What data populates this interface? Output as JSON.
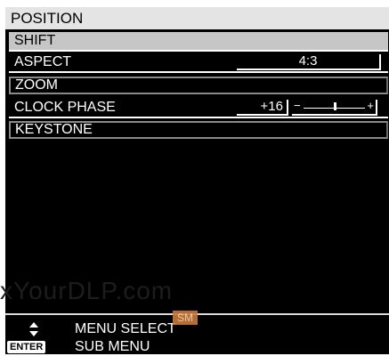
{
  "menu": {
    "title": "POSITION",
    "items": [
      {
        "label": "SHIFT"
      },
      {
        "label": "ASPECT",
        "value": "4:3"
      },
      {
        "label": "ZOOM"
      },
      {
        "label": "CLOCK PHASE",
        "value": "+16",
        "slider_min": "−",
        "slider_max": "+",
        "slider_level": 0.5
      },
      {
        "label": "KEYSTONE"
      }
    ]
  },
  "watermark": "xYourDLP.com",
  "footer": {
    "select_label": "MENU SELECT",
    "sub_label": "SUB MENU",
    "enter_badge": "ENTER",
    "sm_badge": "SM"
  },
  "icons": [
    "up-down-arrows-icon"
  ],
  "colors": {
    "background": "#000000",
    "title_bar": "#e4e4e4",
    "selected_row": "#c6c6c6",
    "text": "#ffffff"
  }
}
